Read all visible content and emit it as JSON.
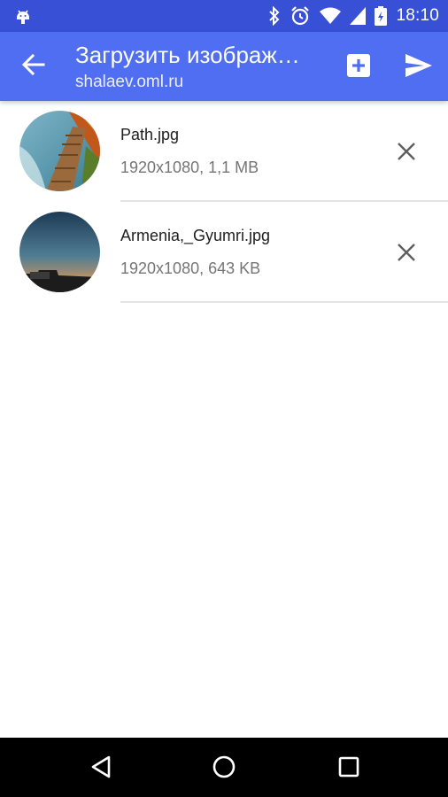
{
  "status_bar": {
    "time": "18:10",
    "icons": [
      "android-icon",
      "bluetooth-icon",
      "alarm-icon",
      "wifi-icon",
      "signal-icon",
      "battery-icon"
    ]
  },
  "app_bar": {
    "title": "Загрузить изображ…",
    "subtitle": "shalaev.oml.ru",
    "icons": [
      "back-arrow-icon",
      "add-box-icon",
      "send-icon"
    ],
    "color": "#4f6ef1",
    "status_color": "#3850d6"
  },
  "files": [
    {
      "name": "Path.jpg",
      "meta": "1920x1080, 1,1 MB",
      "thumb_icon": "boardwalk-photo"
    },
    {
      "name": "Armenia,_Gyumri.jpg",
      "meta": "1920x1080, 643 KB",
      "thumb_icon": "night-sky-photo"
    }
  ],
  "nav_bar": {
    "icons": [
      "back-triangle-icon",
      "home-circle-icon",
      "recents-square-icon"
    ]
  }
}
